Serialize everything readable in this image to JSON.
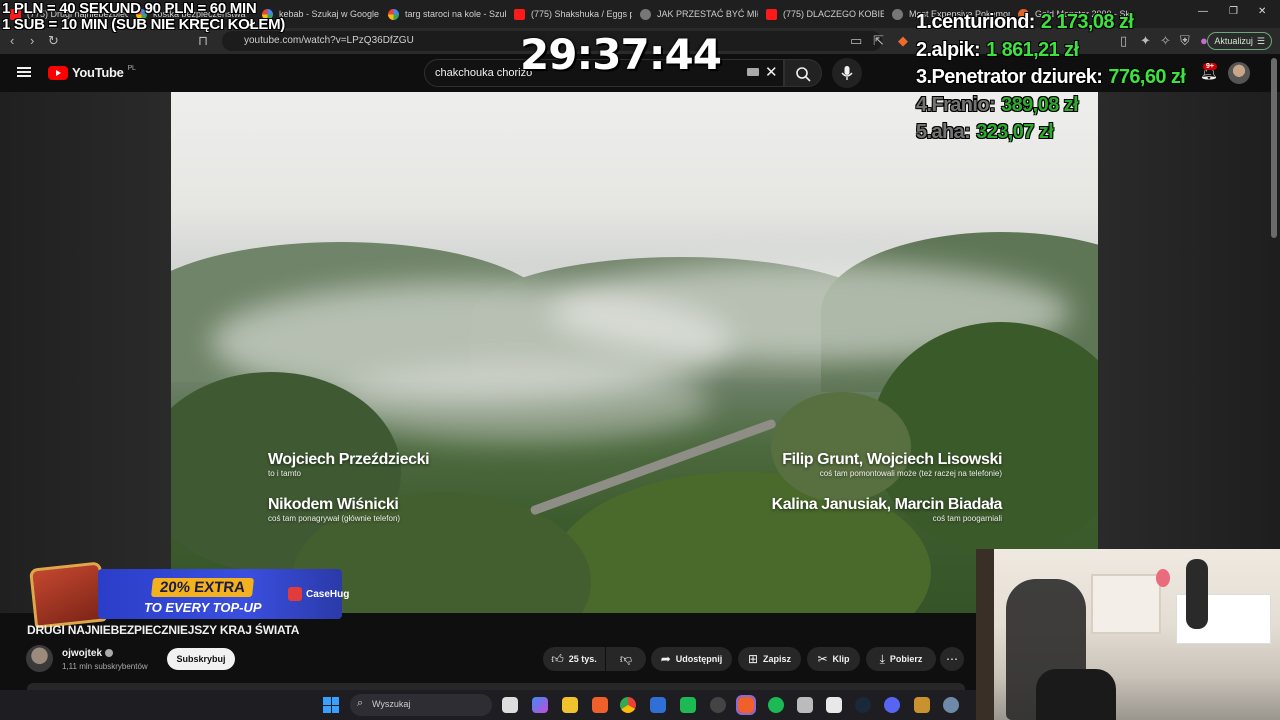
{
  "browser": {
    "tabs": [
      {
        "label": "(775) Drugi najniebezpieczn",
        "icon": "youtube-icon"
      },
      {
        "label": "kostka bezpieczeństwa",
        "icon": "google-icon"
      },
      {
        "label": "kebab - Szukaj w Google",
        "icon": "google-icon"
      },
      {
        "label": "targ staroci na kole - Szuk",
        "icon": "google-icon"
      },
      {
        "label": "(775) Shakshuka / Eggs po",
        "icon": "youtube-icon"
      },
      {
        "label": "JAK PRZESTAĆ BYĆ MIŁYM",
        "icon": "globe-icon"
      },
      {
        "label": "(775) DLACZEGO KOBIETY",
        "icon": "youtube-icon"
      },
      {
        "label": "Most Expensive Pokemon",
        "icon": "globe-icon"
      },
      {
        "label": "Gold Monster 2000 - Sk",
        "icon": "shop-icon"
      }
    ],
    "url": "youtube.com/watch?v=LPzQ36DfZGU",
    "update_button": "Aktualizuj"
  },
  "youtube": {
    "logo_text": "YouTube",
    "region": "PL",
    "search_query": "chakchouka chorizo",
    "notifications_badge": "9+"
  },
  "overlay": {
    "rules_line1": "1 PLN = 40 SEKUND 90 PLN = 60 MIN",
    "rules_line2": "1 SUB = 10 MIN (SUB NIE KRĘCI KOŁEM)",
    "timer": "29:37:44",
    "leaderboard": [
      {
        "name": "1.centuriond:",
        "amount": "2 173,08 zł"
      },
      {
        "name": "2.alpik:",
        "amount": "1 861,21 zł"
      },
      {
        "name": "3.Penetrator dziurek:",
        "amount": "776,60 zł"
      },
      {
        "name": "4.Franio:",
        "amount": "389,08 zł"
      },
      {
        "name": "5.aha:",
        "amount": "323,07 zł"
      }
    ]
  },
  "video": {
    "credits": [
      {
        "name": "Wojciech Przeździecki",
        "role": "to i tamto"
      },
      {
        "name": "Nikodem Wiśnicki",
        "role": "coś tam ponagrywał (głównie telefon)"
      },
      {
        "name": "Filip Grunt, Wojciech Lisowski",
        "role": "coś tam pomontowali może (też raczej na telefonie)"
      },
      {
        "name": "Kalina Janusiak, Marcin Biadała",
        "role": "coś tam poogarniali"
      }
    ],
    "title": "DRUGI NAJNIEBEZPIECZNIEJSZY KRAJ ŚWIATA",
    "channel": "ojwojtek",
    "subscribers": "1,11 mln subskrybentów",
    "subscribe_label": "Subskrybuj",
    "likes": "25 tys.",
    "share_label": "Udostępnij",
    "save_label": "Zapisz",
    "clip_label": "Klip",
    "download_label": "Pobierz"
  },
  "ad": {
    "line1": "20% EXTRA",
    "line2": "TO EVERY TOP-UP",
    "brand": "CaseHug"
  },
  "taskbar": {
    "search_placeholder": "Wyszukaj"
  }
}
